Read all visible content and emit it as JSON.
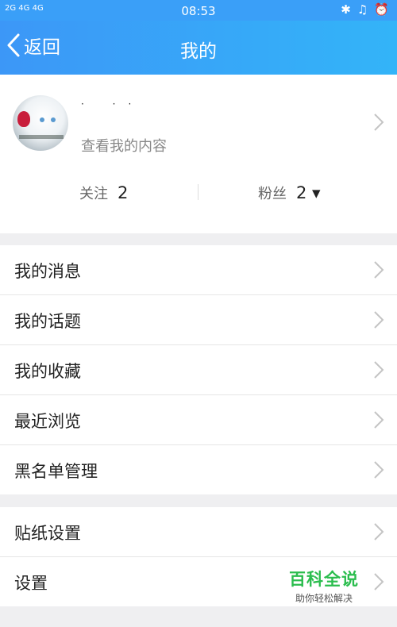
{
  "status_bar": {
    "signal_left": "2G 4G 4G",
    "time": "08:53",
    "icons": [
      "bluetooth-icon",
      "bell-off-icon",
      "alarm-icon"
    ]
  },
  "navbar": {
    "back_label": "返回",
    "title": "我的"
  },
  "profile": {
    "name": "· ··",
    "subtitle": "查看我的内容",
    "following_label": "关注",
    "following_count": "2",
    "followers_label": "粉丝",
    "followers_count": "2 ▾"
  },
  "menu_group_1": [
    {
      "label": "我的消息"
    },
    {
      "label": "我的话题"
    },
    {
      "label": "我的收藏"
    },
    {
      "label": "最近浏览"
    },
    {
      "label": "黑名单管理"
    }
  ],
  "menu_group_2": [
    {
      "label": "贴纸设置"
    },
    {
      "label": "设置"
    }
  ],
  "watermark": {
    "title": "百科全说",
    "subtitle": "助你轻松解决"
  },
  "colors": {
    "header_start": "#3c97f7",
    "header_end": "#33b4f8",
    "background": "#efeff1",
    "watermark_green": "#2bbd4e"
  }
}
